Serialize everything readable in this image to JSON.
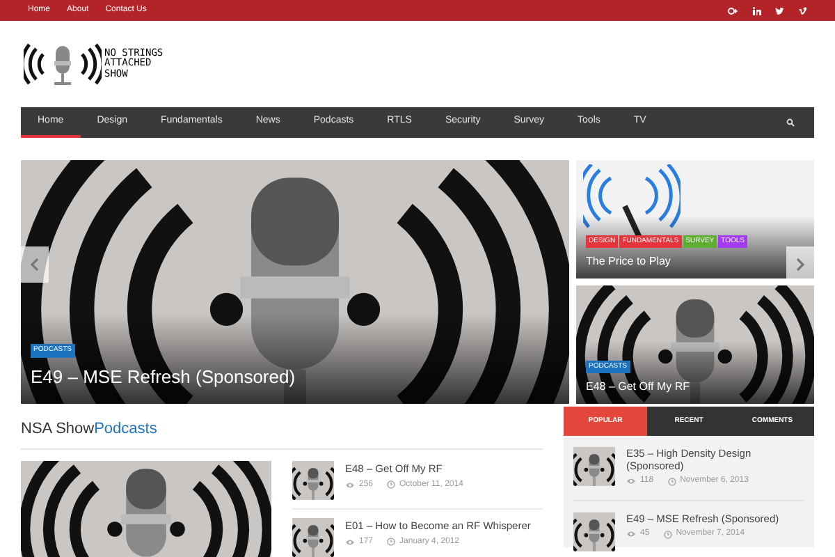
{
  "top_bar": {
    "links": [
      "Home",
      "About",
      "Contact Us"
    ]
  },
  "logo": {
    "lines": [
      "NO STRINGS",
      "ATTACHED",
      "SHOW"
    ]
  },
  "nav": {
    "items": [
      {
        "label": "Home",
        "selected": true
      },
      {
        "label": "Design",
        "selected": false
      },
      {
        "label": "Fundamentals",
        "selected": false
      },
      {
        "label": "News",
        "selected": false
      },
      {
        "label": "Podcasts",
        "selected": false
      },
      {
        "label": "RTLS",
        "selected": false
      },
      {
        "label": "Security",
        "selected": false
      },
      {
        "label": "Survey",
        "selected": false
      },
      {
        "label": "Tools",
        "selected": false
      },
      {
        "label": "TV",
        "selected": false
      }
    ]
  },
  "slider": {
    "main": {
      "category": "PODCASTS",
      "title": "E49 – MSE Refresh (Sponsored)"
    },
    "side": [
      {
        "kind": "antenna",
        "tags": [
          {
            "label": "DESIGN",
            "color": "#e4343c"
          },
          {
            "label": "FUNDAMENTALS",
            "color": "#e4343c"
          },
          {
            "label": "SURVEY",
            "color": "#5fae32"
          },
          {
            "label": "TOOLS",
            "color": "#a33af0"
          }
        ],
        "title": "The Price to Play"
      },
      {
        "kind": "microphone",
        "tags": [
          {
            "label": "PODCASTS",
            "color": "#1e73be"
          }
        ],
        "title": "E48 – Get Off My RF"
      }
    ]
  },
  "section": {
    "title": "NSA Show",
    "highlight": "Podcasts",
    "posts": [
      {
        "title": "E48 – Get Off My RF",
        "views": "256",
        "date": "October 11, 2014"
      },
      {
        "title": "E01 – How to Become an RF Whisperer",
        "views": "177",
        "date": "January 4, 2012"
      }
    ]
  },
  "sidebar": {
    "tabs": [
      {
        "label": "POPULAR",
        "selected": true
      },
      {
        "label": "RECENT",
        "selected": false
      },
      {
        "label": "COMMENTS",
        "selected": false
      }
    ],
    "items": [
      {
        "title": "E35 – High Density Design (Sponsored)",
        "views": "118",
        "date": "November 6, 2013"
      },
      {
        "title": "E49 – MSE Refresh (Sponsored)",
        "views": "45",
        "date": "November 7, 2014"
      }
    ]
  }
}
